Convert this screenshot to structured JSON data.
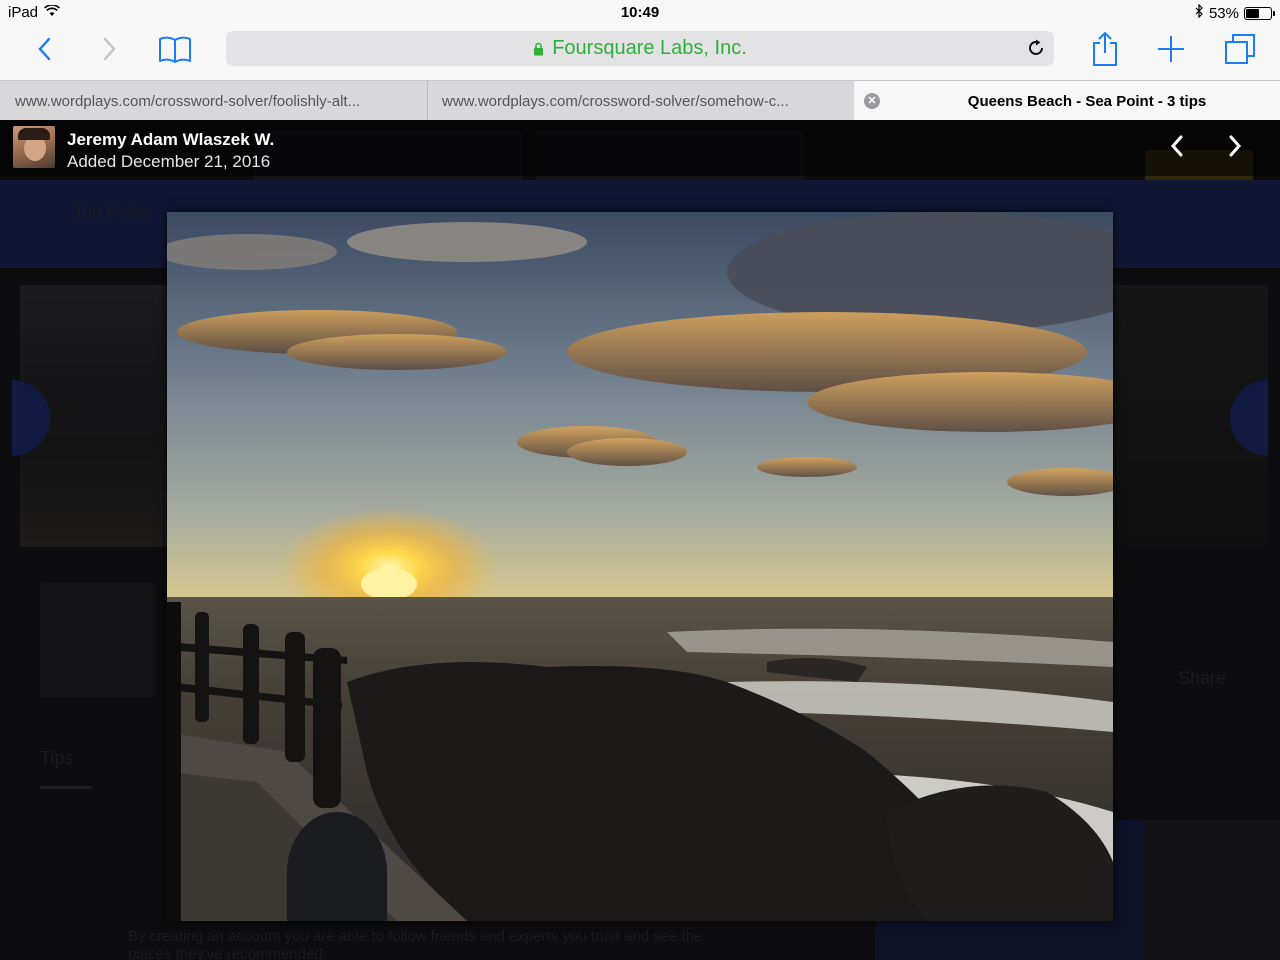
{
  "status": {
    "device": "iPad",
    "time": "10:49",
    "battery": "53%",
    "battery_level": 0.53
  },
  "toolbar": {
    "site": "Foursquare Labs, Inc."
  },
  "tabs": [
    {
      "title": "www.wordplays.com/crossword-solver/foolishly-alt..."
    },
    {
      "title": "www.wordplays.com/crossword-solver/somehow-c..."
    },
    {
      "title": "Queens Beach - Sea Point - 3 tips"
    }
  ],
  "viewer": {
    "user_name": "Jeremy Adam Wlaszek W.",
    "added": "Added December 21, 2016"
  },
  "background_page": {
    "top_picks": "Top Picks",
    "tips": "Tips",
    "share": "Share",
    "footer": "By creating an account you are able to follow friends and experts you trust and see the places they've recommended."
  }
}
